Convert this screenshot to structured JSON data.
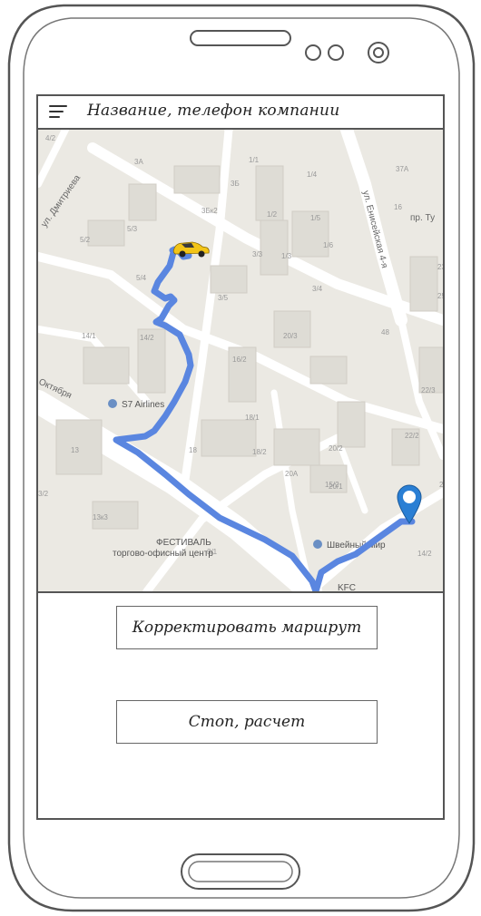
{
  "app": {
    "title": "Название, телефон компании",
    "menu_icon": "hamburger-menu-icon"
  },
  "map": {
    "vehicle_icon": "taxi-car-icon",
    "destination_icon": "map-pin-icon",
    "route_color": "#5a86e0",
    "pin_color": "#2a7fd4",
    "streets": {
      "dmitrieva": "ул. Дмитриева",
      "yeniseiskaya": "ул. Енисейская 4-я",
      "oktyabrya": "Октября",
      "pr_tu": "пр. Ту"
    },
    "poi": {
      "s7": "S7 Airlines",
      "festival_1": "ФЕСТИВАЛЬ",
      "festival_2": "торгово-офисный центр",
      "shveiny": "Швейный мир",
      "kfc": "KFC"
    },
    "house_numbers": [
      "4/2",
      "3А",
      "1/1",
      "1/4",
      "3Б",
      "37А",
      "16",
      "5/3",
      "3Бк2",
      "1/2",
      "1/5",
      "5/2",
      "3/3",
      "1/6",
      "1/3",
      "5/4",
      "3/4",
      "23",
      "3/5",
      "25",
      "14/1",
      "20/3",
      "48",
      "14/2",
      "16/2",
      "22/3",
      "18/1",
      "13",
      "20/2",
      "22/2",
      "18",
      "18/2",
      "20А",
      "15/2",
      "20/1",
      "3/2",
      "13к3",
      "14/2",
      "21",
      "3/1"
    ]
  },
  "buttons": {
    "correct_route": "Корректировать маршрут",
    "stop_calc": "Стоп, расчет"
  }
}
